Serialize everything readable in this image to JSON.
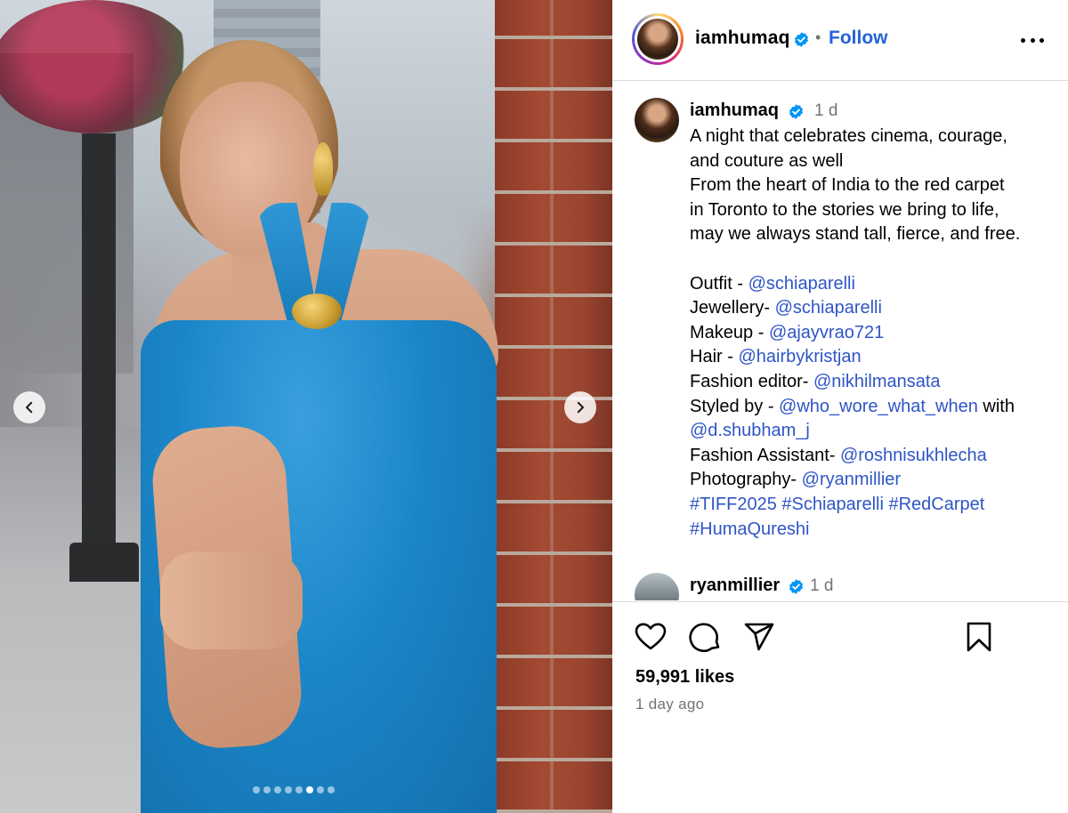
{
  "post": {
    "username": "iamhumaq",
    "separator": "•",
    "follow_label": "Follow",
    "carousel": {
      "slide_count": 8,
      "active_index": 5
    },
    "caption": {
      "time": "1 d",
      "lines": [
        [
          {
            "t": "A night that celebrates cinema, courage,"
          }
        ],
        [
          {
            "t": "and couture as well"
          }
        ],
        [
          {
            "t": "From the heart of India to the red carpet"
          }
        ],
        [
          {
            "t": "in Toronto to the stories we bring to life,"
          }
        ],
        [
          {
            "t": "may we always stand tall, fierce, and free."
          }
        ],
        [],
        [
          {
            "t": "Outfit - "
          },
          {
            "t": "@schiaparelli",
            "k": "mention"
          }
        ],
        [
          {
            "t": "Jewellery- "
          },
          {
            "t": "@schiaparelli",
            "k": "mention"
          }
        ],
        [
          {
            "t": "Makeup - "
          },
          {
            "t": "@ajayvrao721",
            "k": "mention"
          }
        ],
        [
          {
            "t": "Hair - "
          },
          {
            "t": "@hairbykristjan",
            "k": "mention"
          }
        ],
        [
          {
            "t": "Fashion editor- "
          },
          {
            "t": "@nikhilmansata",
            "k": "mention"
          }
        ],
        [
          {
            "t": "Styled by - "
          },
          {
            "t": "@who_wore_what_when",
            "k": "mention"
          },
          {
            "t": " with"
          }
        ],
        [
          {
            "t": "@d.shubham_j",
            "k": "mention"
          }
        ],
        [
          {
            "t": "Fashion Assistant- "
          },
          {
            "t": "@roshnisukhlecha",
            "k": "mention"
          }
        ],
        [
          {
            "t": "Photography- "
          },
          {
            "t": "@ryanmillier",
            "k": "mention"
          }
        ],
        [
          {
            "t": "#TIFF2025",
            "k": "hashtag"
          },
          {
            "t": " "
          },
          {
            "t": "#Schiaparelli",
            "k": "hashtag"
          },
          {
            "t": " "
          },
          {
            "t": "#RedCarpet",
            "k": "hashtag"
          }
        ],
        [
          {
            "t": "#HumaQureshi",
            "k": "hashtag"
          }
        ]
      ]
    },
    "next_comment": {
      "username": "ryanmillier",
      "time": "1 d"
    },
    "likes_text": "59,991 likes",
    "posted_text": "1 day ago",
    "icons": {
      "prev": "chevron-left-icon",
      "next": "chevron-right-icon",
      "like": "heart-icon",
      "comment": "comment-bubble-icon",
      "share": "paper-plane-icon",
      "save": "bookmark-icon",
      "more": "more-horizontal-icon",
      "verified": "verified-badge-icon"
    },
    "colors": {
      "link": "#2f55c7",
      "follow": "#2463d6",
      "verified": "#0095f6",
      "muted": "#737373",
      "divider": "#dbdbdb"
    }
  }
}
